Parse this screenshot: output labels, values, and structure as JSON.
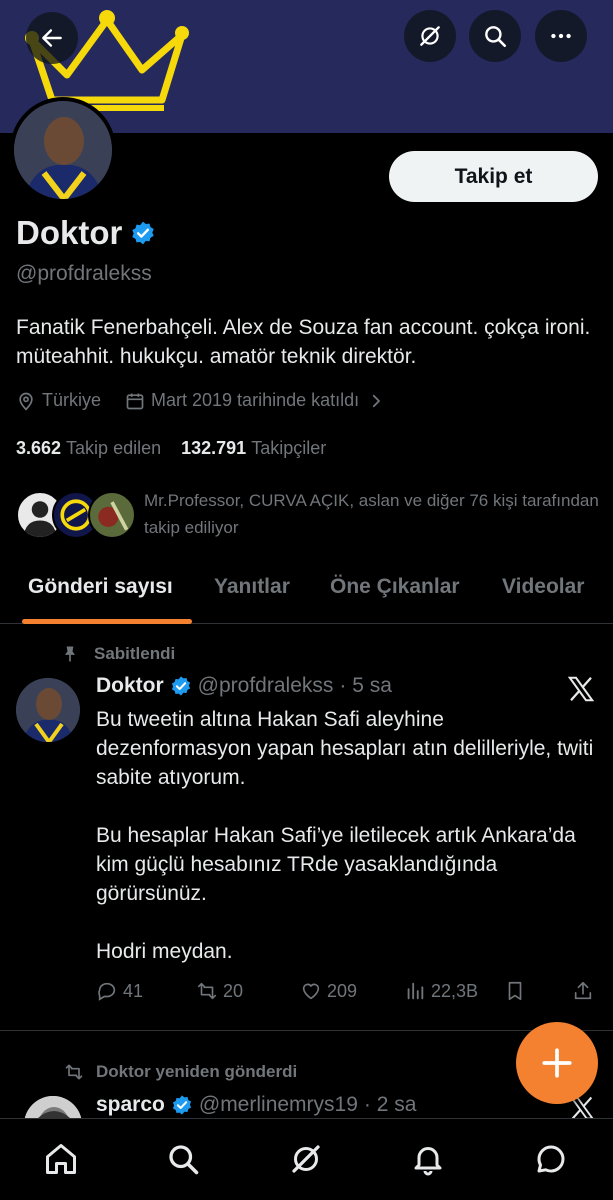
{
  "header": {
    "back_icon": "arrow-left-icon",
    "grok_icon": "grok-icon",
    "search_icon": "search-icon",
    "more_icon": "more-icon"
  },
  "profile": {
    "name": "Doktor",
    "handle": "@profdralekss",
    "bio": "Fanatik Fenerbahçeli. Alex de Souza fan account. çokça ironi. müteahhit. hukukçu. amatör teknik direktör.",
    "location": "Türkiye",
    "joined": "Mart 2019 tarihinde katıldı",
    "follow_label": "Takip et",
    "following_count": "3.662",
    "following_label": "Takip edilen",
    "followers_count": "132.791",
    "followers_label": "Takipçiler",
    "followed_by": "Mr.Professor, CURVA AÇIK, aslan ve diğer 76 kişi tarafından takip ediliyor"
  },
  "tabs": [
    "Gönderi sayısı",
    "Yanıtlar",
    "Öne Çıkanlar",
    "Videolar"
  ],
  "pinned_post": {
    "pinned_label": "Sabitlendi",
    "author": "Doktor",
    "handle": "@profdralekss",
    "time": "· 5 sa",
    "paragraphs": [
      "Bu tweetin altına Hakan Safi aleyhine dezenformasyon yapan hesapları atın delilleriyle, twiti sabite atıyorum.",
      "Bu hesaplar Hakan Safi’ye iletilecek artık Ankara’da kim güçlü hesabınız TRde yasaklandığında görürsünüz.",
      "Hodri meydan."
    ],
    "replies": "41",
    "reposts": "20",
    "likes": "209",
    "views": "22,3B"
  },
  "second_post": {
    "repost_label": "Doktor yeniden gönderdi",
    "author": "sparco",
    "handle": "@merlinemrys19",
    "time": "· 2 sa"
  },
  "colors": {
    "accent": "#f4812f",
    "banner": "#26295c",
    "verified": "#1d9bf0",
    "muted": "#71767b"
  }
}
